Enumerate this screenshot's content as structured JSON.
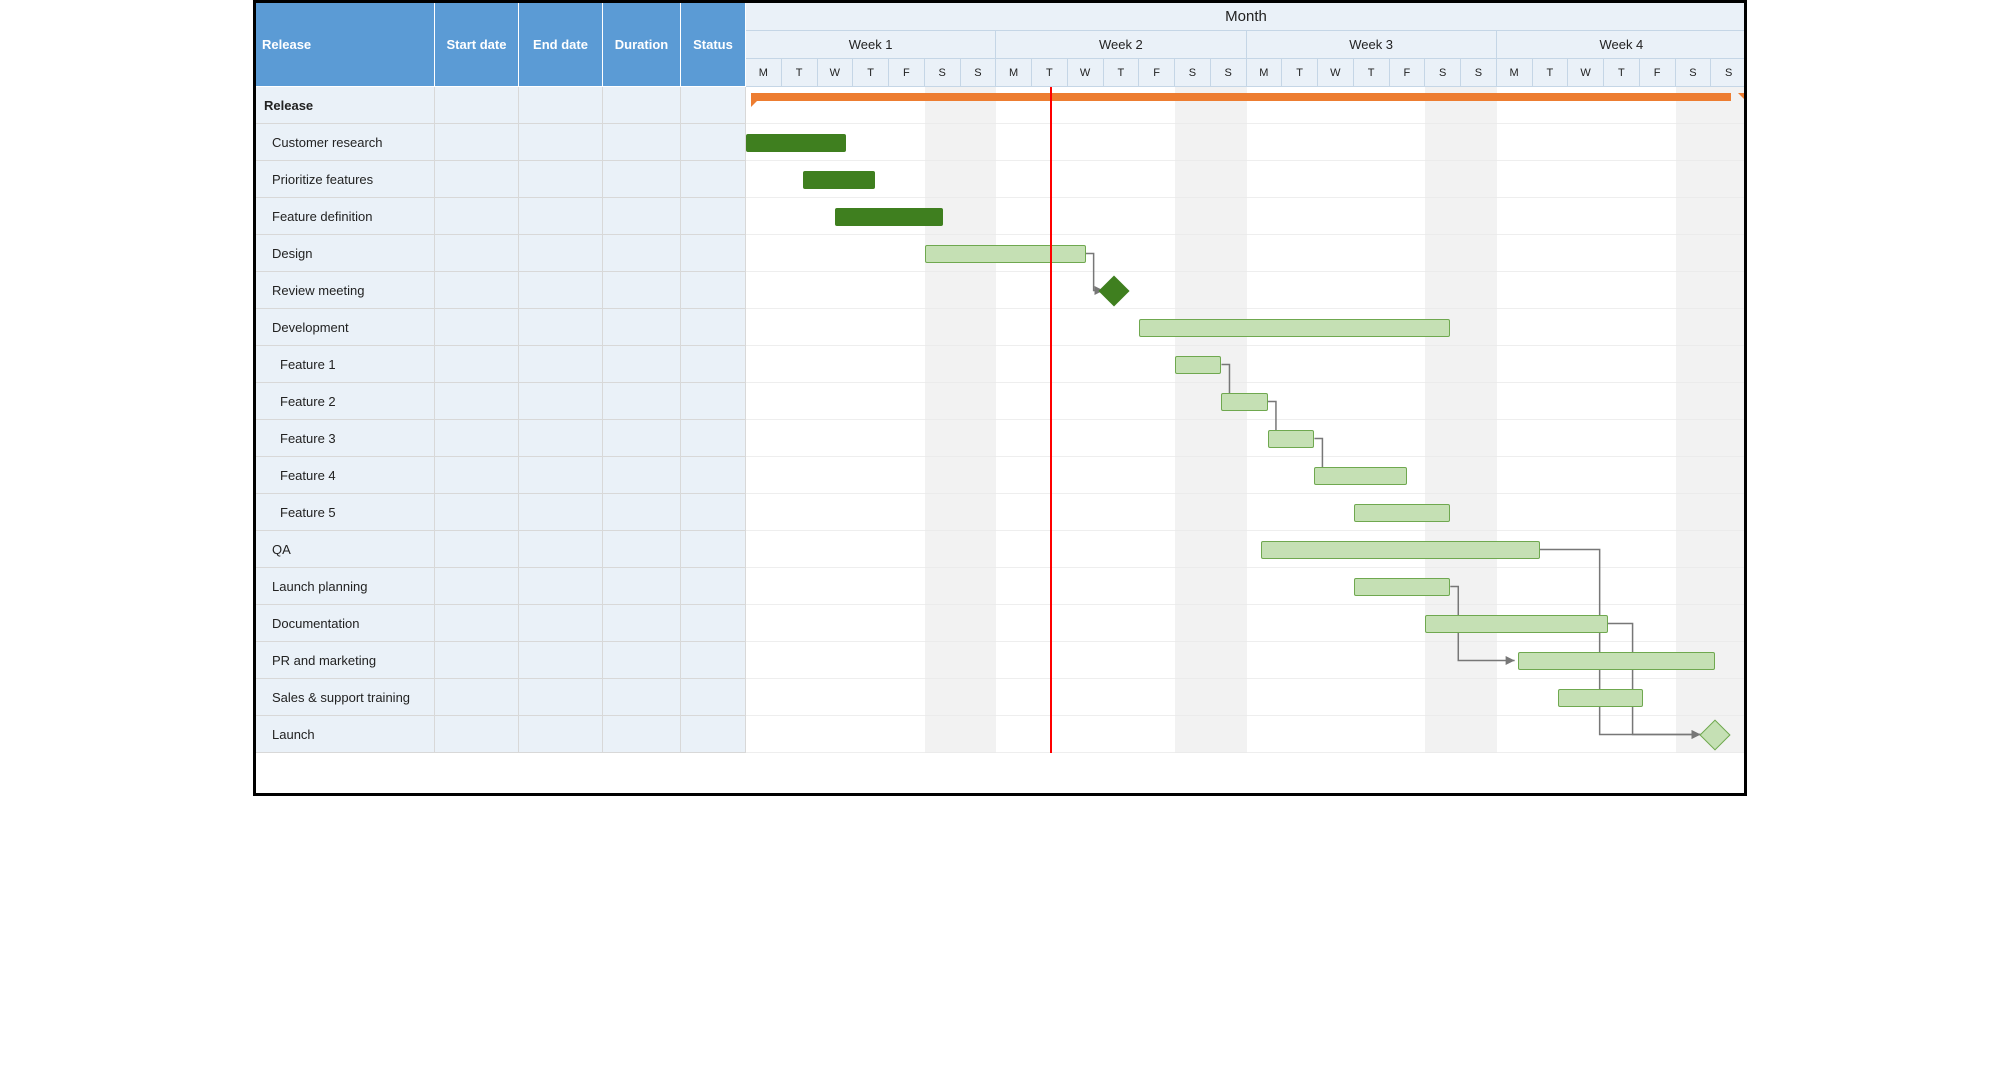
{
  "colors": {
    "header_blue": "#5B9BD5",
    "header_light": "#EAF1F8",
    "bar_done": "#3F7F1F",
    "bar_open_fill": "#C5E0B4",
    "bar_open_border": "#6FA84F",
    "summary": "#ED7D31",
    "today": "#ff0000"
  },
  "columns": {
    "release": "Release",
    "start_date": "Start date",
    "end_date": "End date",
    "duration": "Duration",
    "status": "Status"
  },
  "timeline": {
    "period_label": "Month",
    "weeks": [
      "Week 1",
      "Week 2",
      "Week 3",
      "Week 4"
    ],
    "day_labels": [
      "M",
      "T",
      "W",
      "T",
      "F",
      "S",
      "S"
    ],
    "total_days": 28,
    "today_day_index": 8
  },
  "rows": [
    {
      "name": "Release",
      "indent": 0,
      "bold": true,
      "type": "summary",
      "start": 0,
      "end": 27
    },
    {
      "name": "Customer research",
      "indent": 1,
      "type": "bar",
      "status": "done",
      "start": 0,
      "end": 2.8
    },
    {
      "name": "Prioritize features",
      "indent": 1,
      "type": "bar",
      "status": "done",
      "start": 1.6,
      "end": 3.6
    },
    {
      "name": "Feature definition",
      "indent": 1,
      "type": "bar",
      "status": "done",
      "start": 2.5,
      "end": 5.5
    },
    {
      "name": "Design",
      "indent": 1,
      "type": "bar",
      "status": "open",
      "start": 5.0,
      "end": 9.5
    },
    {
      "name": "Review meeting",
      "indent": 1,
      "type": "milestone",
      "status": "done",
      "at": 10.3
    },
    {
      "name": "Development",
      "indent": 1,
      "type": "bar",
      "status": "open",
      "start": 11,
      "end": 19.7
    },
    {
      "name": "Feature 1",
      "indent": 2,
      "type": "bar",
      "status": "open",
      "start": 12,
      "end": 13.3
    },
    {
      "name": "Feature 2",
      "indent": 2,
      "type": "bar",
      "status": "open",
      "start": 13.3,
      "end": 14.6
    },
    {
      "name": "Feature 3",
      "indent": 2,
      "type": "bar",
      "status": "open",
      "start": 14.6,
      "end": 15.9
    },
    {
      "name": "Feature 4",
      "indent": 2,
      "type": "bar",
      "status": "open",
      "start": 15.9,
      "end": 18.5
    },
    {
      "name": "Feature 5",
      "indent": 2,
      "type": "bar",
      "status": "open",
      "start": 17.0,
      "end": 19.7
    },
    {
      "name": "QA",
      "indent": 1,
      "type": "bar",
      "status": "open",
      "start": 14.4,
      "end": 22.2
    },
    {
      "name": "Launch planning",
      "indent": 1,
      "type": "bar",
      "status": "open",
      "start": 17.0,
      "end": 19.7
    },
    {
      "name": "Documentation",
      "indent": 1,
      "type": "bar",
      "status": "open",
      "start": 19.0,
      "end": 24.1
    },
    {
      "name": "PR and  marketing",
      "indent": 1,
      "type": "bar",
      "status": "open",
      "start": 21.6,
      "end": 27.1
    },
    {
      "name": "Sales & support training",
      "indent": 1,
      "type": "bar",
      "status": "open",
      "start": 22.7,
      "end": 25.1
    },
    {
      "name": "Launch",
      "indent": 1,
      "type": "milestone",
      "status": "open",
      "at": 27.1
    }
  ],
  "connectors": [
    {
      "from_row": 4,
      "from_day": 9.5,
      "to_row": 5,
      "to_day": 10.0
    },
    {
      "from_row": 7,
      "from_day": 13.3,
      "to_row": 8,
      "to_day": 13.4
    },
    {
      "from_row": 8,
      "from_day": 14.6,
      "to_row": 9,
      "to_day": 14.7
    },
    {
      "from_row": 9,
      "from_day": 15.9,
      "to_row": 10,
      "to_day": 16.0
    },
    {
      "from_row": 12,
      "from_day": 22.2,
      "to_row": 17,
      "to_day": 26.7
    },
    {
      "from_row": 13,
      "from_day": 19.7,
      "to_row": 15,
      "to_day": 21.5
    },
    {
      "from_row": 14,
      "from_day": 24.1,
      "to_row": 17,
      "to_day": 26.7
    }
  ],
  "chart_data": {
    "type": "gantt",
    "title": "",
    "x_unit": "day_index (0..27, Month = 4 weeks × 7 days)",
    "today": 8,
    "tasks": [
      {
        "id": "release",
        "name": "Release",
        "type": "summary",
        "start": 0,
        "end": 27
      },
      {
        "id": "cust",
        "name": "Customer research",
        "start": 0,
        "end": 2.8,
        "status": "complete"
      },
      {
        "id": "prio",
        "name": "Prioritize features",
        "start": 1.6,
        "end": 3.6,
        "status": "complete"
      },
      {
        "id": "fdef",
        "name": "Feature definition",
        "start": 2.5,
        "end": 5.5,
        "status": "complete"
      },
      {
        "id": "design",
        "name": "Design",
        "start": 5.0,
        "end": 9.5,
        "status": "open"
      },
      {
        "id": "review",
        "name": "Review meeting",
        "type": "milestone",
        "at": 10.3,
        "status": "complete"
      },
      {
        "id": "dev",
        "name": "Development",
        "start": 11,
        "end": 19.7,
        "status": "open"
      },
      {
        "id": "f1",
        "name": "Feature 1",
        "start": 12,
        "end": 13.3,
        "parent": "dev",
        "status": "open"
      },
      {
        "id": "f2",
        "name": "Feature 2",
        "start": 13.3,
        "end": 14.6,
        "parent": "dev",
        "status": "open"
      },
      {
        "id": "f3",
        "name": "Feature 3",
        "start": 14.6,
        "end": 15.9,
        "parent": "dev",
        "status": "open"
      },
      {
        "id": "f4",
        "name": "Feature 4",
        "start": 15.9,
        "end": 18.5,
        "parent": "dev",
        "status": "open"
      },
      {
        "id": "f5",
        "name": "Feature 5",
        "start": 17.0,
        "end": 19.7,
        "parent": "dev",
        "status": "open"
      },
      {
        "id": "qa",
        "name": "QA",
        "start": 14.4,
        "end": 22.2,
        "status": "open"
      },
      {
        "id": "lp",
        "name": "Launch planning",
        "start": 17.0,
        "end": 19.7,
        "status": "open"
      },
      {
        "id": "doc",
        "name": "Documentation",
        "start": 19.0,
        "end": 24.1,
        "status": "open"
      },
      {
        "id": "pr",
        "name": "PR and  marketing",
        "start": 21.6,
        "end": 27.1,
        "status": "open"
      },
      {
        "id": "train",
        "name": "Sales & support training",
        "start": 22.7,
        "end": 25.1,
        "status": "open"
      },
      {
        "id": "launch",
        "name": "Launch",
        "type": "milestone",
        "at": 27.1,
        "status": "open"
      }
    ],
    "dependencies": [
      [
        "design",
        "review"
      ],
      [
        "f1",
        "f2"
      ],
      [
        "f2",
        "f3"
      ],
      [
        "f3",
        "f4"
      ],
      [
        "qa",
        "launch"
      ],
      [
        "lp",
        "pr"
      ],
      [
        "doc",
        "launch"
      ]
    ]
  }
}
